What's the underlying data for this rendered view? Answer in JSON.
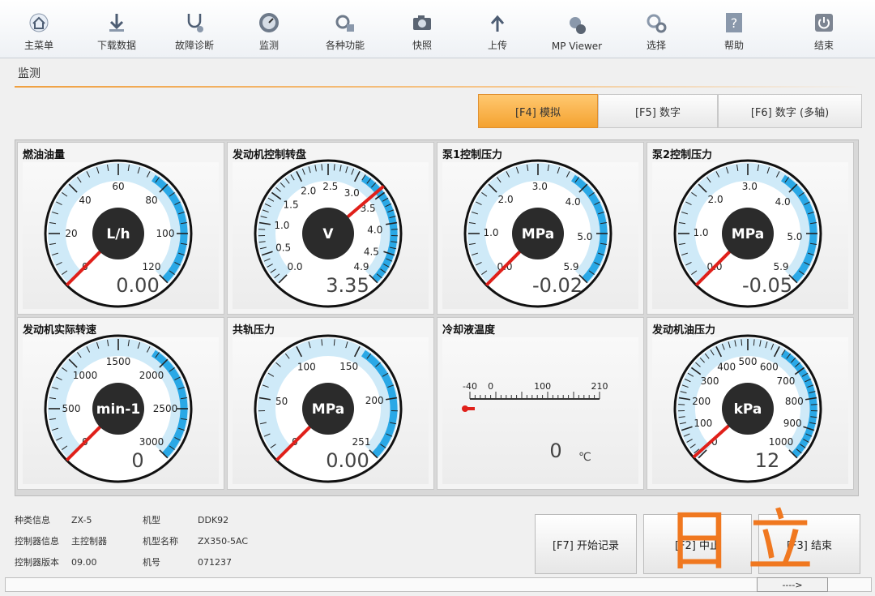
{
  "toolbar": {
    "items": [
      {
        "label": "主菜单",
        "icon": "home-icon"
      },
      {
        "label": "下载数据",
        "icon": "download-icon"
      },
      {
        "label": "故障诊断",
        "icon": "stethoscope-icon"
      },
      {
        "label": "监测",
        "icon": "monitor-icon"
      },
      {
        "label": "各种功能",
        "icon": "tools-icon"
      },
      {
        "label": "快照",
        "icon": "camera-icon"
      },
      {
        "label": "上传",
        "icon": "upload-icon"
      },
      {
        "label": "MP Viewer",
        "icon": "viewer-icon"
      },
      {
        "label": "选择",
        "icon": "gears-icon"
      },
      {
        "label": "帮助",
        "icon": "help-icon"
      },
      {
        "label": "结束",
        "icon": "power-icon"
      }
    ]
  },
  "section_title": "监测",
  "mode_tabs": [
    {
      "label": "[F4] 模拟",
      "active": true
    },
    {
      "label": "[F5] 数字",
      "active": false
    },
    {
      "label": "[F6] 数字 (多轴)",
      "active": false
    }
  ],
  "gauges": [
    {
      "title": "燃油油量",
      "unit": "L/h",
      "value_text": "0.00",
      "value": 0,
      "min": 0,
      "max": 120,
      "ticks": [
        "0",
        "20",
        "40",
        "60",
        "80",
        "100",
        "120"
      ]
    },
    {
      "title": "发动机控制转盘",
      "unit": "V",
      "value_text": "3.35",
      "value": 3.35,
      "min": 0,
      "max": 4.9,
      "ticks": [
        "0.0",
        "0.5",
        "1.0",
        "1.5",
        "2.0",
        "2.5",
        "3.0",
        "3.5",
        "4.0",
        "4.5",
        "4.9"
      ]
    },
    {
      "title": "泵1控制压力",
      "unit": "MPa",
      "value_text": "-0.02",
      "value": -0.02,
      "min": 0,
      "max": 5.9,
      "ticks": [
        "0.0",
        "1.0",
        "2.0",
        "3.0",
        "4.0",
        "5.0",
        "5.9"
      ]
    },
    {
      "title": "泵2控制压力",
      "unit": "MPa",
      "value_text": "-0.05",
      "value": -0.05,
      "min": 0,
      "max": 5.9,
      "ticks": [
        "0.0",
        "1.0",
        "2.0",
        "3.0",
        "4.0",
        "5.0",
        "5.9"
      ]
    },
    {
      "title": "发动机实际转速",
      "unit": "min-1",
      "value_text": "0",
      "value": 0,
      "min": 0,
      "max": 3000,
      "ticks": [
        "0",
        "500",
        "1000",
        "1500",
        "2000",
        "2500",
        "3000"
      ]
    },
    {
      "title": "共轨压力",
      "unit": "MPa",
      "value_text": "0.00",
      "value": 0,
      "min": 0,
      "max": 251,
      "ticks": [
        "0",
        "50",
        "100",
        "150",
        "200",
        "251"
      ]
    },
    {
      "title": "冷却液温度",
      "type": "thermo",
      "unit": "℃",
      "value_text": "0",
      "value": 0,
      "min": -40,
      "max": 210,
      "ticks": [
        "-40",
        "0",
        "100",
        "210"
      ]
    },
    {
      "title": "发动机油压力",
      "unit": "kPa",
      "value_text": "12",
      "value": 12,
      "min": 0,
      "max": 1000,
      "ticks": [
        "0",
        "100",
        "200",
        "300",
        "400",
        "500",
        "600",
        "700",
        "800",
        "900",
        "1000"
      ]
    }
  ],
  "info": {
    "rows": [
      {
        "k1": "种类信息",
        "v1": "ZX-5",
        "k2": "机型",
        "v2": "DDK92"
      },
      {
        "k1": "控制器信息",
        "v1": "主控制器",
        "k2": "机型名称",
        "v2": "ZX350-5AC"
      },
      {
        "k1": "控制器版本",
        "v1": "09.00",
        "k2": "机号",
        "v2": "071237"
      }
    ]
  },
  "buttons": {
    "start_record": "[F7] 开始记录",
    "stop": "[F2] 中止",
    "end": "[F3] 结束"
  },
  "status": {
    "arrow": "---->"
  },
  "brand": "日立",
  "colors": {
    "accent": "#f4a230",
    "gauge_band": "#2aa8e6",
    "needle": "#e0201a",
    "hub": "#2b2b2b"
  }
}
